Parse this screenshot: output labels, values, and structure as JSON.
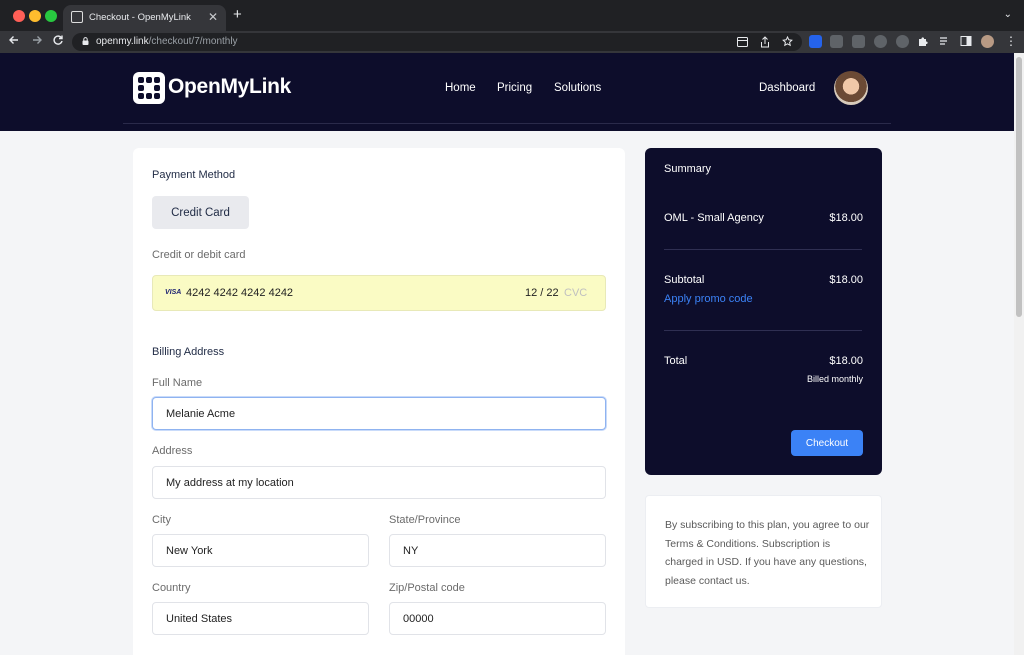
{
  "browser": {
    "tab_title": "Checkout - OpenMyLink",
    "tab_close": "✕",
    "new_tab": "+",
    "tab_menu": "⌄",
    "url_host": "openmy.link",
    "url_path": "/checkout/7/monthly",
    "icons": [
      "back-arrow-icon",
      "forward-arrow-icon",
      "reload-icon",
      "lock-icon",
      "star-icon",
      "share-icon",
      "extension-icon",
      "profile-icon"
    ]
  },
  "site": {
    "brand": "OpenMyLink",
    "nav": [
      "Home",
      "Pricing",
      "Solutions"
    ],
    "dashboard": "Dashboard"
  },
  "payment": {
    "title": "Payment Method",
    "method_button": "Credit Card",
    "card_label": "Credit or debit card",
    "card_brand": "VISA",
    "card_number": "4242 4242 4242 4242",
    "card_expiry": "12 / 22",
    "card_cvc_placeholder": "CVC"
  },
  "billing": {
    "title": "Billing Address",
    "full_name_label": "Full Name",
    "full_name": "Melanie Acme",
    "address_label": "Address",
    "address": "My address at my location",
    "city_label": "City",
    "city": "New York",
    "state_label": "State/Province",
    "state": "NY",
    "country_label": "Country",
    "country": "United States",
    "zip_label": "Zip/Postal code",
    "zip": "00000"
  },
  "summary": {
    "title": "Summary",
    "plan_name": "OML - Small Agency",
    "plan_price": "$18.00",
    "subtotal_label": "Subtotal",
    "subtotal": "$18.00",
    "promo": "Apply promo code",
    "total_label": "Total",
    "total": "$18.00",
    "billing_cycle": "Billed monthly",
    "checkout": "Checkout"
  },
  "terms": "By subscribing to this plan, you agree to our Terms & Conditions. Subscription is charged in USD. If you have any questions, please contact us.",
  "colors": {
    "header_bg": "#0d0d2b",
    "accent": "#3b82f6",
    "card_field_bg": "#fafbc4"
  }
}
